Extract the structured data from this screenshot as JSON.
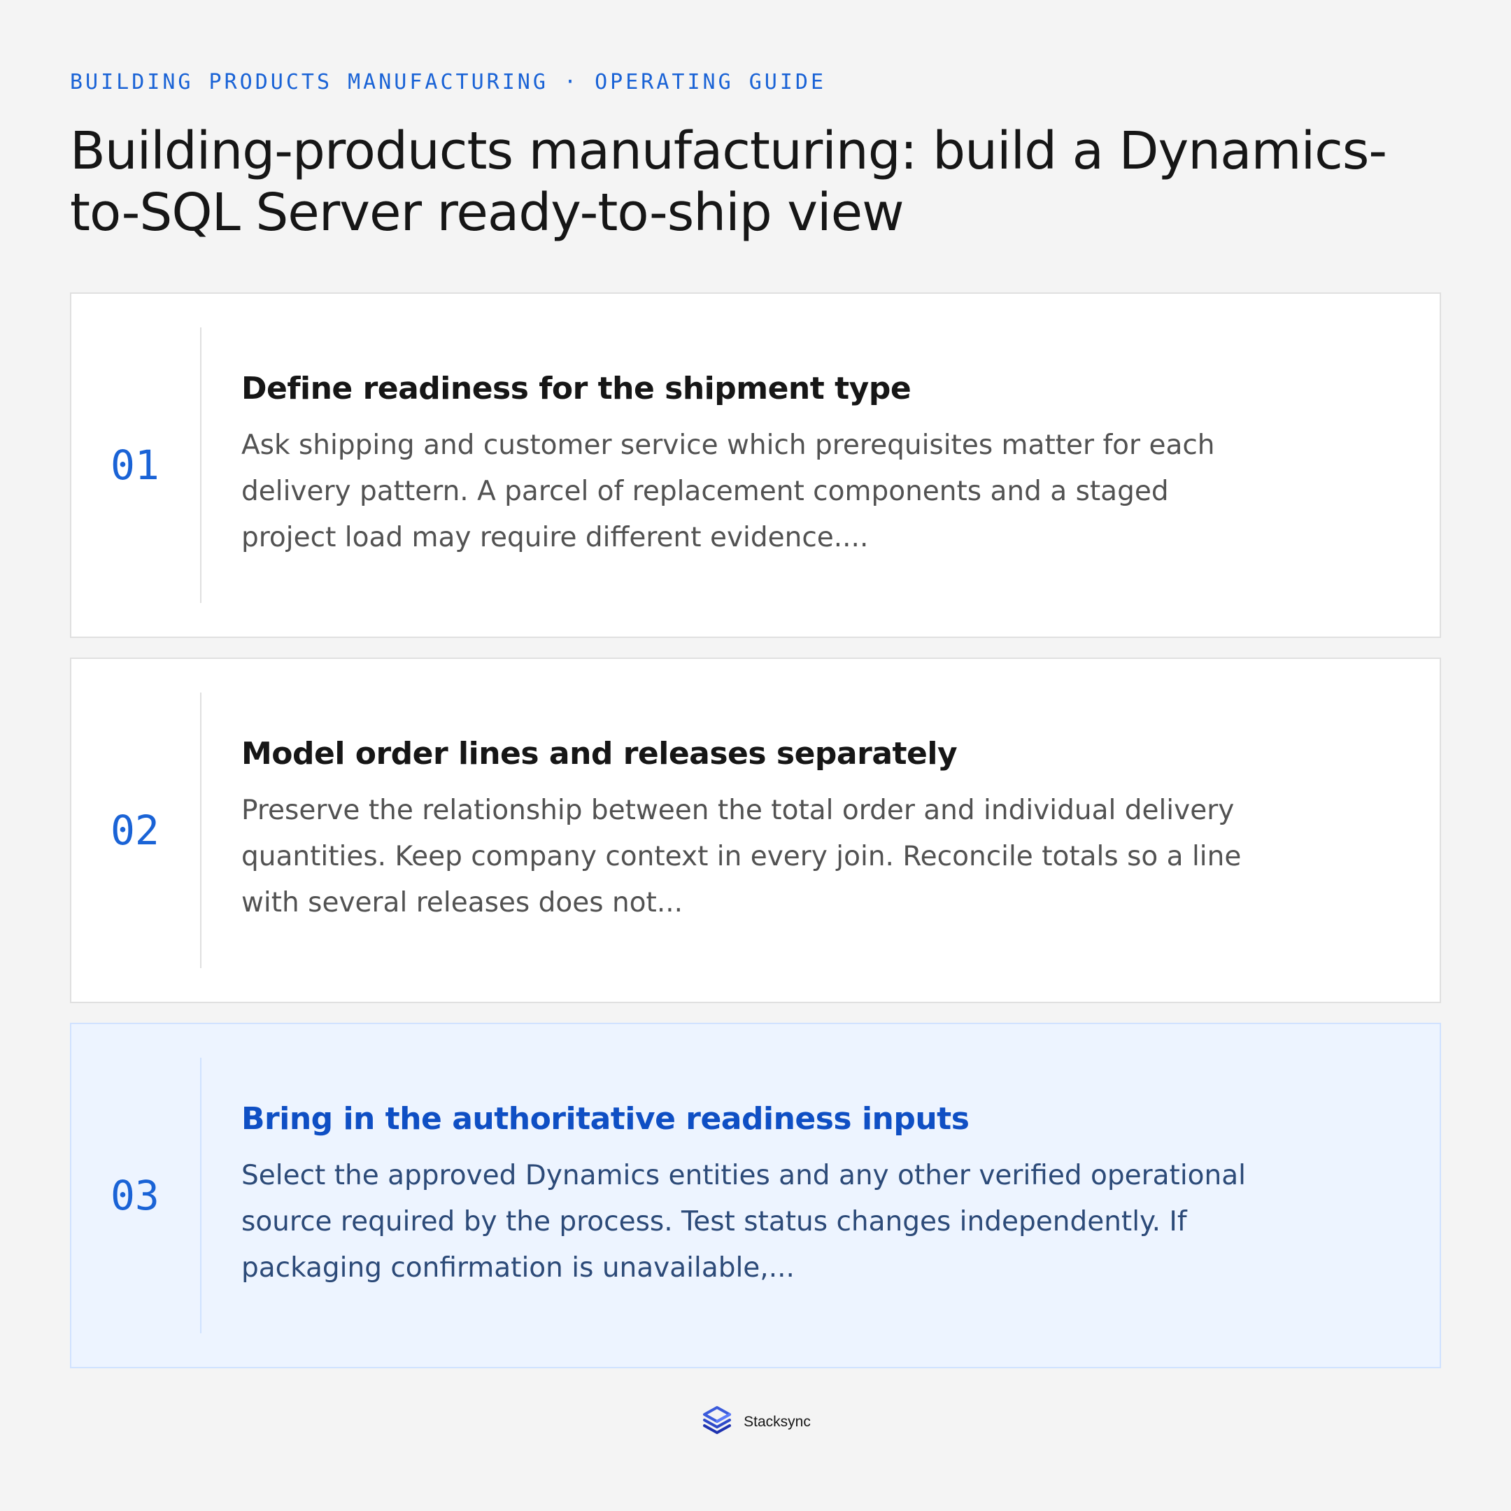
{
  "header": {
    "eyebrow": "BUILDING PRODUCTS MANUFACTURING · OPERATING GUIDE",
    "title": "Building-products manufacturing: build a Dynamics-to-SQL Server ready-to-ship view"
  },
  "steps": [
    {
      "number": "01",
      "title": "Define readiness for the shipment type",
      "description": "Ask shipping and customer service which prerequisites matter for each delivery pattern. A parcel of replacement components and a staged project load may require different evidence....",
      "active": false
    },
    {
      "number": "02",
      "title": "Model order lines and releases separately",
      "description": "Preserve the relationship between the total order and individual delivery quantities. Keep company context in every join. Reconcile totals so a line with several releases does not...",
      "active": false
    },
    {
      "number": "03",
      "title": "Bring in the authoritative readiness inputs",
      "description": "Select the approved Dynamics entities and any other verified operational source required by the process. Test status changes independently. If packaging confirmation is unavailable,...",
      "active": true
    }
  ],
  "footer": {
    "brand": "Stacksync",
    "logo_icon": "stacksync-logo-icon"
  },
  "colors": {
    "background": "#f4f4f4",
    "accent": "#1a63d6",
    "active_title": "#0f4fc4",
    "active_card_bg": "#edf4ff",
    "card_bg": "#ffffff",
    "border": "#e0e0e0",
    "text_primary": "#161616",
    "text_secondary": "#525252"
  }
}
